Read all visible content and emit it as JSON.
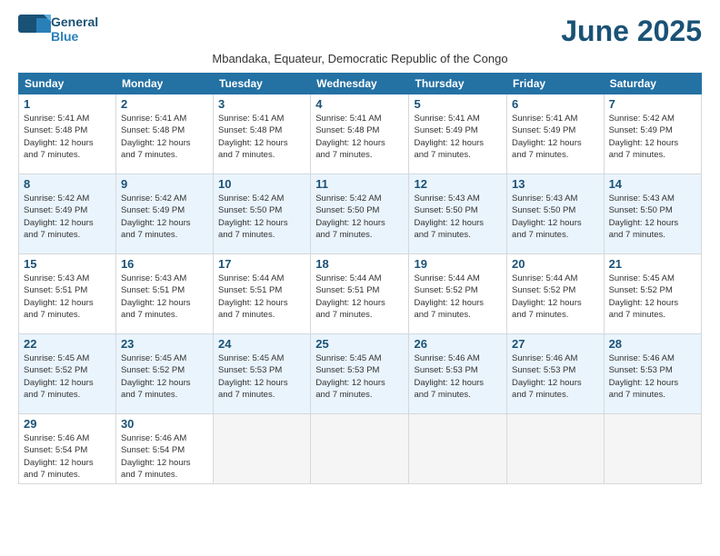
{
  "header": {
    "logo_line1": "General",
    "logo_line2": "Blue",
    "month_year": "June 2025",
    "subtitle": "Mbandaka, Equateur, Democratic Republic of the Congo"
  },
  "days_of_week": [
    "Sunday",
    "Monday",
    "Tuesday",
    "Wednesday",
    "Thursday",
    "Friday",
    "Saturday"
  ],
  "weeks": [
    [
      {
        "day": "1",
        "rise": "5:41 AM",
        "set": "5:48 PM",
        "daylight": "12 hours and 7 minutes."
      },
      {
        "day": "2",
        "rise": "5:41 AM",
        "set": "5:48 PM",
        "daylight": "12 hours and 7 minutes."
      },
      {
        "day": "3",
        "rise": "5:41 AM",
        "set": "5:48 PM",
        "daylight": "12 hours and 7 minutes."
      },
      {
        "day": "4",
        "rise": "5:41 AM",
        "set": "5:48 PM",
        "daylight": "12 hours and 7 minutes."
      },
      {
        "day": "5",
        "rise": "5:41 AM",
        "set": "5:49 PM",
        "daylight": "12 hours and 7 minutes."
      },
      {
        "day": "6",
        "rise": "5:41 AM",
        "set": "5:49 PM",
        "daylight": "12 hours and 7 minutes."
      },
      {
        "day": "7",
        "rise": "5:42 AM",
        "set": "5:49 PM",
        "daylight": "12 hours and 7 minutes."
      }
    ],
    [
      {
        "day": "8",
        "rise": "5:42 AM",
        "set": "5:49 PM",
        "daylight": "12 hours and 7 minutes."
      },
      {
        "day": "9",
        "rise": "5:42 AM",
        "set": "5:49 PM",
        "daylight": "12 hours and 7 minutes."
      },
      {
        "day": "10",
        "rise": "5:42 AM",
        "set": "5:50 PM",
        "daylight": "12 hours and 7 minutes."
      },
      {
        "day": "11",
        "rise": "5:42 AM",
        "set": "5:50 PM",
        "daylight": "12 hours and 7 minutes."
      },
      {
        "day": "12",
        "rise": "5:43 AM",
        "set": "5:50 PM",
        "daylight": "12 hours and 7 minutes."
      },
      {
        "day": "13",
        "rise": "5:43 AM",
        "set": "5:50 PM",
        "daylight": "12 hours and 7 minutes."
      },
      {
        "day": "14",
        "rise": "5:43 AM",
        "set": "5:50 PM",
        "daylight": "12 hours and 7 minutes."
      }
    ],
    [
      {
        "day": "15",
        "rise": "5:43 AM",
        "set": "5:51 PM",
        "daylight": "12 hours and 7 minutes."
      },
      {
        "day": "16",
        "rise": "5:43 AM",
        "set": "5:51 PM",
        "daylight": "12 hours and 7 minutes."
      },
      {
        "day": "17",
        "rise": "5:44 AM",
        "set": "5:51 PM",
        "daylight": "12 hours and 7 minutes."
      },
      {
        "day": "18",
        "rise": "5:44 AM",
        "set": "5:51 PM",
        "daylight": "12 hours and 7 minutes."
      },
      {
        "day": "19",
        "rise": "5:44 AM",
        "set": "5:52 PM",
        "daylight": "12 hours and 7 minutes."
      },
      {
        "day": "20",
        "rise": "5:44 AM",
        "set": "5:52 PM",
        "daylight": "12 hours and 7 minutes."
      },
      {
        "day": "21",
        "rise": "5:45 AM",
        "set": "5:52 PM",
        "daylight": "12 hours and 7 minutes."
      }
    ],
    [
      {
        "day": "22",
        "rise": "5:45 AM",
        "set": "5:52 PM",
        "daylight": "12 hours and 7 minutes."
      },
      {
        "day": "23",
        "rise": "5:45 AM",
        "set": "5:52 PM",
        "daylight": "12 hours and 7 minutes."
      },
      {
        "day": "24",
        "rise": "5:45 AM",
        "set": "5:53 PM",
        "daylight": "12 hours and 7 minutes."
      },
      {
        "day": "25",
        "rise": "5:45 AM",
        "set": "5:53 PM",
        "daylight": "12 hours and 7 minutes."
      },
      {
        "day": "26",
        "rise": "5:46 AM",
        "set": "5:53 PM",
        "daylight": "12 hours and 7 minutes."
      },
      {
        "day": "27",
        "rise": "5:46 AM",
        "set": "5:53 PM",
        "daylight": "12 hours and 7 minutes."
      },
      {
        "day": "28",
        "rise": "5:46 AM",
        "set": "5:53 PM",
        "daylight": "12 hours and 7 minutes."
      }
    ],
    [
      {
        "day": "29",
        "rise": "5:46 AM",
        "set": "5:54 PM",
        "daylight": "12 hours and 7 minutes."
      },
      {
        "day": "30",
        "rise": "5:46 AM",
        "set": "5:54 PM",
        "daylight": "12 hours and 7 minutes."
      },
      null,
      null,
      null,
      null,
      null
    ]
  ],
  "labels": {
    "sunrise": "Sunrise:",
    "sunset": "Sunset:",
    "daylight": "Daylight:"
  }
}
